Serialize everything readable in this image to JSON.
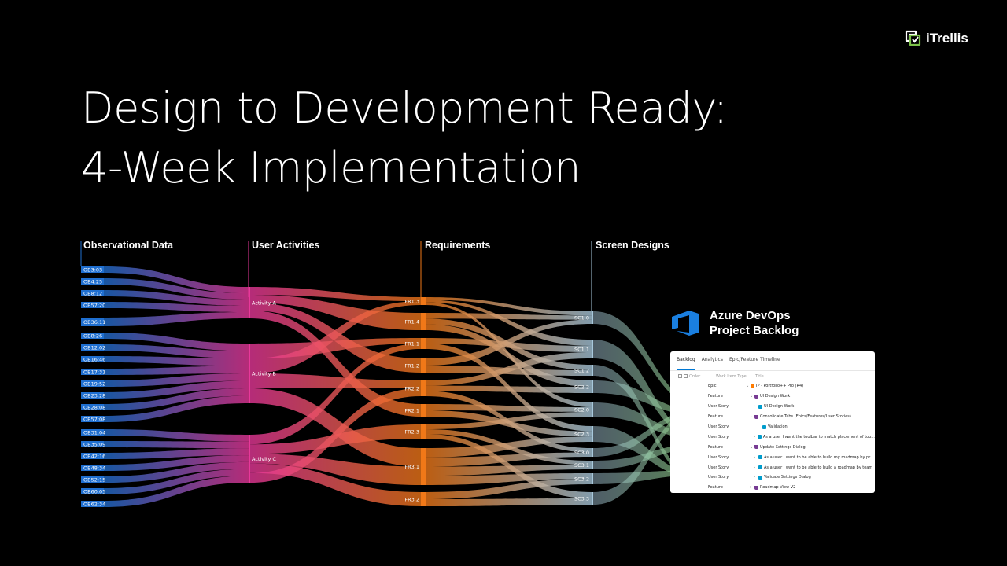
{
  "header": {
    "title_line1": "Design to Development Ready:",
    "title_line2": "4-Week Implementation",
    "logo_text": "iTrellis"
  },
  "columns": [
    "Observational Data",
    "User Activities",
    "Requirements",
    "Screen Designs"
  ],
  "observations": [
    "OB3:03",
    "OB4:25",
    "OB8:12",
    "OB57:20",
    "OB36:11",
    "OB8:26",
    "OB12:02",
    "OB16:46",
    "OB17:31",
    "OB19:52",
    "OB23:28",
    "OB28:08",
    "OB57:08",
    "OB31:04",
    "OB35:09",
    "OB42:16",
    "OB48:34",
    "OB52:15",
    "OB60:05",
    "OB62:34"
  ],
  "activities": [
    "Activity A",
    "Activity B",
    "Activity C"
  ],
  "requirements": [
    "FR1.3",
    "FR1.4",
    "FR1.1",
    "FR1.2",
    "FR2.2",
    "FR2.1",
    "FR2.3",
    "FR3.1",
    "FR3.2"
  ],
  "screens": [
    "SC1.0",
    "SC1.1",
    "SC1.2",
    "SC2.2",
    "SC2.0",
    "SC2.3",
    "SC3.0",
    "SC3.1",
    "SC3.2",
    "SC3.3"
  ],
  "colors": {
    "observations": "#1f6fd0",
    "activities": "#e8389a",
    "requirements": "#f07818",
    "screens": "#a8c8dc",
    "backlog_flow": "#7fc26a"
  },
  "azure": {
    "line1": "Azure DevOps",
    "line2": "Project Backlog",
    "icon": "azure-devops-icon"
  },
  "backlog": {
    "tabs": [
      "Backlog",
      "Analytics",
      "Epic/Feature Timeline"
    ],
    "col_order": "Order",
    "col_type": "Work Item Type",
    "col_title": "Title",
    "rows": [
      {
        "type": "Epic",
        "title": "IP - Portfolio++ Pro (R4)",
        "icon": "crown-icon",
        "chevron": "⌄"
      },
      {
        "type": "Feature",
        "title": "UI Design Work",
        "icon": "trophy-icon",
        "chevron": "⌄"
      },
      {
        "type": "User Story",
        "title": "UI Design Work",
        "icon": "book-icon",
        "chevron": "›"
      },
      {
        "type": "Feature",
        "title": "Consolidate Tabs (Epics/Features/User Stories)",
        "icon": "trophy-icon",
        "chevron": "⌄"
      },
      {
        "type": "User Story",
        "title": "Validation",
        "icon": "book-icon",
        "chevron": ""
      },
      {
        "type": "User Story",
        "title": "As a user I want the toolbar to match placement of too...",
        "icon": "book-icon",
        "chevron": "›"
      },
      {
        "type": "Feature",
        "title": "Update Settings Dialog",
        "icon": "trophy-icon",
        "chevron": "⌄"
      },
      {
        "type": "User Story",
        "title": "As a user I want to be able to build my roadmap by pr...",
        "icon": "book-icon",
        "chevron": "›"
      },
      {
        "type": "User Story",
        "title": "As a user I want to be able to build a roadmap by team",
        "icon": "book-icon",
        "chevron": "›"
      },
      {
        "type": "User Story",
        "title": "Validate Settings Dialog",
        "icon": "book-icon",
        "chevron": "›"
      },
      {
        "type": "Feature",
        "title": "Roadmap View V2",
        "icon": "trophy-icon",
        "chevron": "›"
      }
    ]
  },
  "flows": {
    "obs_to_act": [
      [
        0,
        0
      ],
      [
        1,
        0
      ],
      [
        2,
        0
      ],
      [
        3,
        0
      ],
      [
        4,
        0
      ],
      [
        5,
        1
      ],
      [
        6,
        1
      ],
      [
        7,
        1
      ],
      [
        8,
        1
      ],
      [
        9,
        1
      ],
      [
        10,
        1
      ],
      [
        11,
        1
      ],
      [
        12,
        1
      ],
      [
        13,
        2
      ],
      [
        14,
        2
      ],
      [
        15,
        2
      ],
      [
        16,
        2
      ],
      [
        17,
        2
      ],
      [
        18,
        2
      ],
      [
        19,
        2
      ]
    ],
    "act_to_req": [
      [
        0,
        0
      ],
      [
        0,
        1
      ],
      [
        0,
        3
      ],
      [
        0,
        5
      ],
      [
        1,
        2
      ],
      [
        1,
        0
      ],
      [
        1,
        4
      ],
      [
        1,
        7
      ],
      [
        2,
        2
      ],
      [
        2,
        6
      ],
      [
        2,
        7
      ],
      [
        2,
        8
      ],
      [
        2,
        4
      ]
    ],
    "req_to_scr": [
      [
        0,
        0
      ],
      [
        0,
        1
      ],
      [
        0,
        4
      ],
      [
        1,
        0
      ],
      [
        1,
        2
      ],
      [
        1,
        3
      ],
      [
        2,
        1
      ],
      [
        2,
        5
      ],
      [
        3,
        0
      ],
      [
        3,
        2
      ],
      [
        4,
        1
      ],
      [
        4,
        3
      ],
      [
        4,
        6
      ],
      [
        5,
        4
      ],
      [
        5,
        5
      ],
      [
        6,
        4
      ],
      [
        6,
        7
      ],
      [
        6,
        9
      ],
      [
        7,
        5
      ],
      [
        7,
        6
      ],
      [
        7,
        7
      ],
      [
        7,
        8
      ],
      [
        8,
        8
      ],
      [
        8,
        9
      ]
    ]
  }
}
